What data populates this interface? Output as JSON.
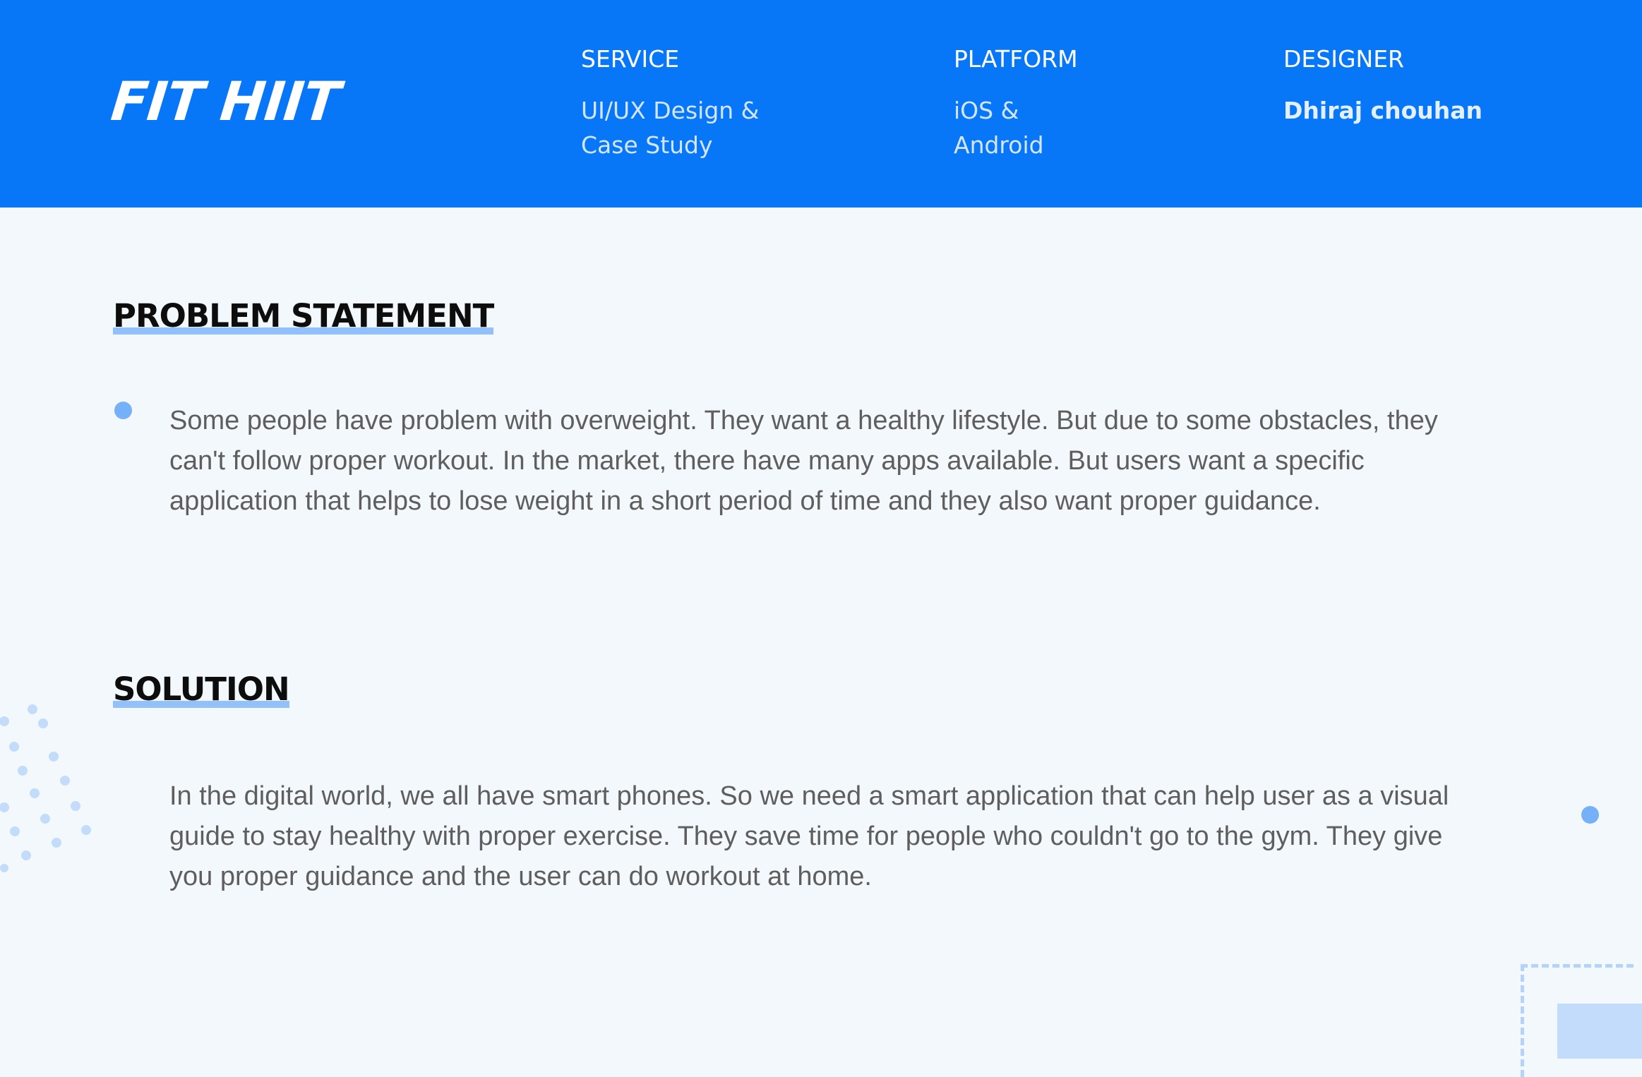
{
  "header": {
    "logo": "FIT HIIT",
    "service": {
      "label": "SERVICE",
      "value": "UI/UX Design & Case Study"
    },
    "platform": {
      "label": "PLATFORM",
      "value": "iOS & Android"
    },
    "designer": {
      "label": "DESIGNER",
      "value": "Dhiraj chouhan"
    }
  },
  "problem": {
    "title": "PROBLEM STATEMENT",
    "text": "Some people have problem with overweight. They want a healthy lifestyle. But due to some obstacles, they can't follow proper workout. In the market, there have many apps available. But users want a specific application that helps to lose weight in a short period of time and they also want proper guidance."
  },
  "solution": {
    "title": "SOLUTION",
    "text": "In the digital world, we all have smart phones. So we need a smart application that can help user as a visual guide to stay healthy with proper exercise. They save time for people who couldn't go to the gym. They give you proper guidance and the user can do workout at home."
  },
  "colors": {
    "brand_blue": "#0777f8",
    "background": "#f3f8fd",
    "accent_light": "#92c0fb",
    "body_text": "#5e5e5e"
  }
}
